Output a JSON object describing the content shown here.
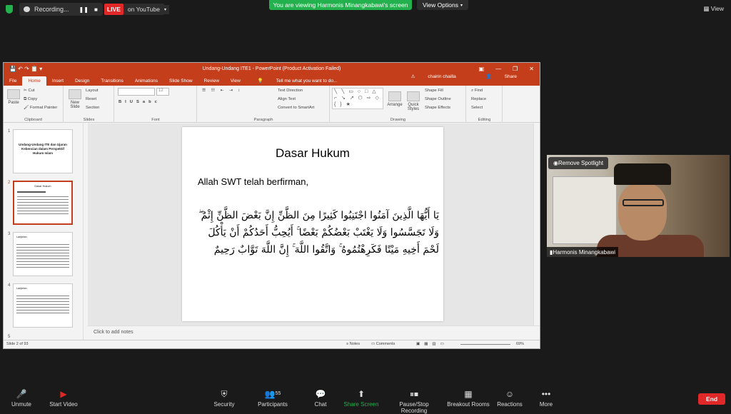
{
  "top": {
    "recording": "Recording...",
    "live": "LIVE",
    "youtube": "on YouTube",
    "viewing_banner": "You are viewing Harmonis Minangkabawi's screen",
    "view_options": "View Options",
    "view": "View"
  },
  "ppt": {
    "title": "Undang-Undang ITE1 - PowerPoint (Product Activation Failed)",
    "tabs": [
      "File",
      "Home",
      "Insert",
      "Design",
      "Transitions",
      "Animations",
      "Slide Show",
      "Review",
      "View"
    ],
    "tell_me": "Tell me what you want to do...",
    "user": "chairin chailla",
    "share": "Share",
    "ribbon": {
      "paste": "Paste",
      "cut": "Cut",
      "copy": "Copy",
      "format_painter": "Format Painter",
      "clipboard": "Clipboard",
      "new_slide": "New Slide",
      "layout": "Layout",
      "reset": "Reset",
      "section": "Section",
      "slides": "Slides",
      "font_size": "12",
      "font": "Font",
      "text_direction": "Text Direction",
      "align_text": "Align Text",
      "convert_smartart": "Convert to SmartArt",
      "paragraph": "Paragraph",
      "arrange": "Arrange",
      "quick_styles": "Quick Styles",
      "shape_fill": "Shape Fill",
      "shape_outline": "Shape Outline",
      "shape_effects": "Shape Effects",
      "drawing": "Drawing",
      "find": "Find",
      "replace": "Replace",
      "select": "Select",
      "editing": "Editing"
    },
    "thumbs": [
      {
        "num": "1",
        "text": "Undang-Undang ITE dan Ujaran Kebencian dalam Perspektif Hukum Islam"
      },
      {
        "num": "2",
        "text": "Dasar Hukum"
      },
      {
        "num": "3",
        "text": "Lanjutan"
      },
      {
        "num": "4",
        "text": "Lanjutan"
      },
      {
        "num": "5",
        "text": ""
      }
    ],
    "slide": {
      "title": "Dasar Hukum",
      "subtitle": "Allah SWT telah berfirman,",
      "arabic": "يَا أَيُّهَا الَّذِينَ آمَنُوا اجْتَنِبُوا كَثِيرًا مِنَ الظَّنِّ إِنَّ بَعْضَ الظَّنِّ إِثْمٌ ۖ وَلَا تَجَسَّسُوا وَلَا يَغْتَبْ بَعْضُكُمْ بَعْضًا ۚ أَيُحِبُّ أَحَدُكُمْ أَنْ يَأْكُلَ لَحْمَ أَخِيهِ مَيْتًا فَكَرِهْتُمُوهُ ۚ وَاتَّقُوا اللَّهَ ۚ إِنَّ اللَّهَ تَوَّابٌ رَحِيمٌ"
    },
    "notes_placeholder": "Click to add notes",
    "status_slide": "Slide 2 of 93",
    "status_notes": "Notes",
    "status_comments": "Comments",
    "zoom": "69%"
  },
  "video": {
    "remove_spotlight": "Remove Spotlight",
    "name": "Harmonis Minangkabawi"
  },
  "bottom": {
    "unmute": "Unmute",
    "start_video": "Start Video",
    "security": "Security",
    "participants": "Participants",
    "participants_count": "55",
    "chat": "Chat",
    "share_screen": "Share Screen",
    "pause_recording": "Pause/Stop Recording",
    "breakout": "Breakout Rooms",
    "reactions": "Reactions",
    "more": "More",
    "end": "End"
  }
}
